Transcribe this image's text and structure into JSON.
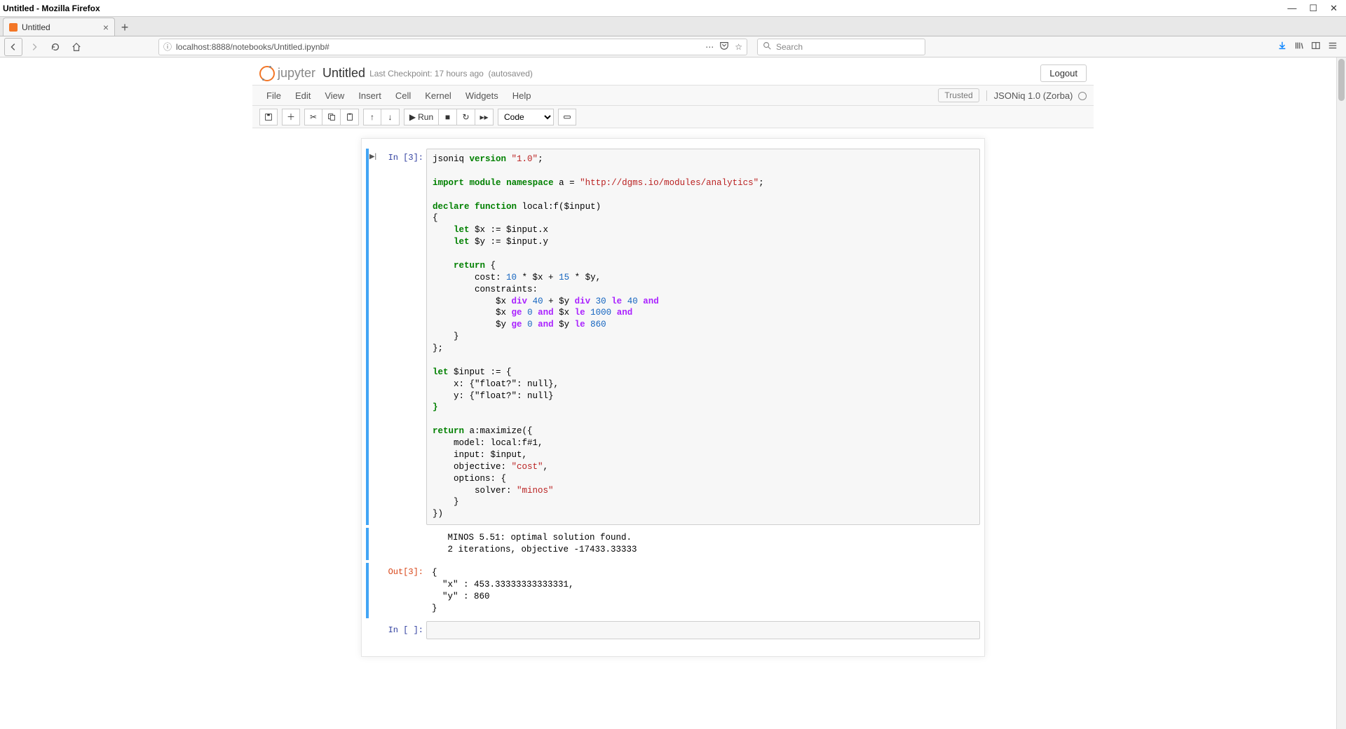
{
  "window": {
    "title": "Untitled - Mozilla Firefox"
  },
  "browser_tab": {
    "title": "Untitled"
  },
  "url_bar": {
    "info_glyph": "ⓘ",
    "url": "localhost:8888/notebooks/Untitled.ipynb#"
  },
  "search": {
    "placeholder": "Search"
  },
  "jupyter": {
    "brand": "jupyter",
    "notebook_title": "Untitled",
    "checkpoint": "Last Checkpoint: 17 hours ago",
    "autosave": "(autosaved)",
    "logout": "Logout",
    "menus": [
      "File",
      "Edit",
      "View",
      "Insert",
      "Cell",
      "Kernel",
      "Widgets",
      "Help"
    ],
    "trusted": "Trusted",
    "kernel": "JSONiq 1.0 (Zorba)",
    "run_label": "Run",
    "celltype": "Code"
  },
  "cell1": {
    "in_prompt": "In [3]:",
    "out_prompt": "Out[3]:",
    "code": {
      "l1_a": "jsoniq ",
      "l1_b": "version",
      "l1_c": " ",
      "l1_d": "\"1.0\"",
      "l1_e": ";",
      "l3_a": "import",
      "l3_b": " ",
      "l3_c": "module",
      "l3_d": " ",
      "l3_e": "namespace",
      "l3_f": " a = ",
      "l3_g": "\"http://dgms.io/modules/analytics\"",
      "l3_h": ";",
      "l5_a": "declare",
      "l5_b": " ",
      "l5_c": "function",
      "l5_d": " local:f($input)",
      "l6": "{",
      "l7_a": "    ",
      "l7_b": "let",
      "l7_c": " $x := $input.x",
      "l8_a": "    ",
      "l8_b": "let",
      "l8_c": " $y := $input.y",
      "l10_a": "    ",
      "l10_b": "return",
      "l10_c": " {",
      "l11_a": "        cost: ",
      "l11_b": "10",
      "l11_c": " * $x + ",
      "l11_d": "15",
      "l11_e": " * $y,",
      "l12": "        constraints:",
      "l13_a": "            $x ",
      "l13_b": "div",
      "l13_c": " ",
      "l13_d": "40",
      "l13_e": " + $y ",
      "l13_f": "div",
      "l13_g": " ",
      "l13_h": "30",
      "l13_i": " ",
      "l13_j": "le",
      "l13_k": " ",
      "l13_l": "40",
      "l13_m": " ",
      "l13_n": "and",
      "l14_a": "            $x ",
      "l14_b": "ge",
      "l14_c": " ",
      "l14_d": "0",
      "l14_e": " ",
      "l14_f": "and",
      "l14_g": " $x ",
      "l14_h": "le",
      "l14_i": " ",
      "l14_j": "1000",
      "l14_k": " ",
      "l14_l": "and",
      "l15_a": "            $y ",
      "l15_b": "ge",
      "l15_c": " ",
      "l15_d": "0",
      "l15_e": " ",
      "l15_f": "and",
      "l15_g": " $y ",
      "l15_h": "le",
      "l15_i": " ",
      "l15_j": "860",
      "l16": "    }",
      "l17": "};",
      "l19_a": "let",
      "l19_b": " $input := {",
      "l20": "    x: {\"float?\": null},",
      "l21": "    y: {\"float?\": null}",
      "l22_a": "}",
      "l24_a": "return",
      "l24_b": " a:maximize({",
      "l25": "    model: local:f#1,",
      "l26": "    input: $input,",
      "l27_a": "    objective: ",
      "l27_b": "\"cost\"",
      "l27_c": ",",
      "l28": "    options: {",
      "l29_a": "        solver: ",
      "l29_b": "\"minos\"",
      "l30": "    }",
      "l31": "})"
    },
    "stdout": "   MINOS 5.51: optimal solution found.\n   2 iterations, objective -17433.33333",
    "result": "{\n  \"x\" : 453.33333333333331,\n  \"y\" : 860\n}"
  },
  "cell2": {
    "in_prompt": "In [ ]:"
  }
}
